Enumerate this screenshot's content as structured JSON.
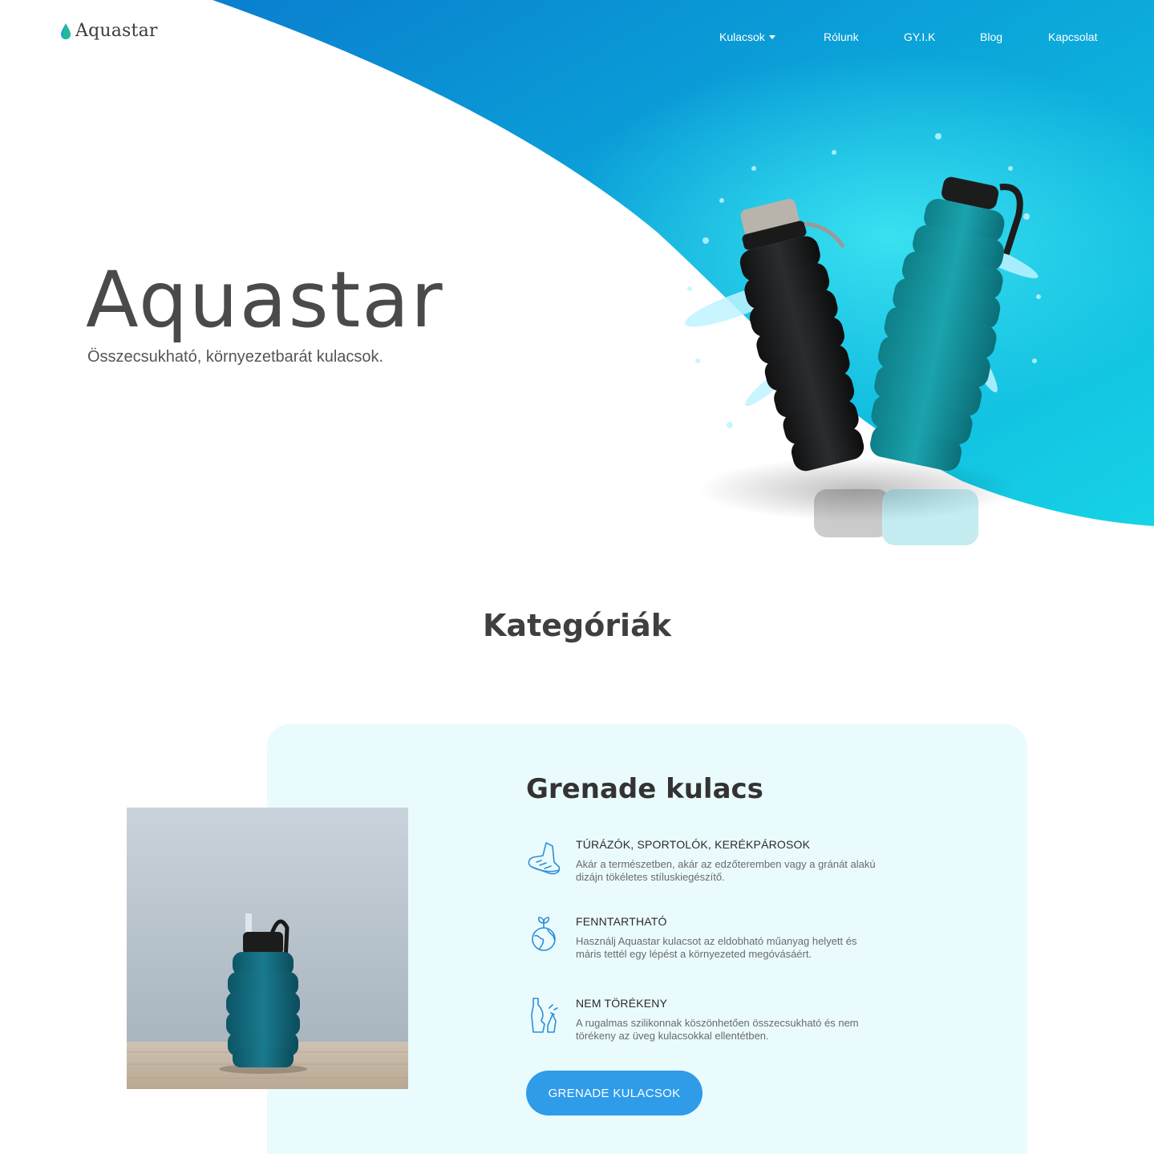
{
  "brand": {
    "logo_text": "Aquastar",
    "logo_icon": "water-drop-icon"
  },
  "nav": {
    "items": [
      {
        "label": "Kulacsok",
        "has_dropdown": true
      },
      {
        "label": "Rólunk"
      },
      {
        "label": "GY.I.K"
      },
      {
        "label": "Blog"
      },
      {
        "label": "Kapcsolat"
      }
    ]
  },
  "hero": {
    "title": "Aquastar",
    "subtitle": "Összecsukható, környezetbarát kulacsok."
  },
  "categories": {
    "heading": "Kategóriák",
    "card": {
      "title": "Grenade kulacs",
      "features": [
        {
          "icon": "running-shoe-icon",
          "title": "TÚRÁZÓK, SPORTOLÓK, KERÉKPÁROSOK",
          "text": "Akár a természetben, akár az edzőteremben vagy a gránát alakú dizájn tökéletes stíluskiegészítő."
        },
        {
          "icon": "earth-plant-icon",
          "title": "FENNTARTHATÓ",
          "text": "Használj Aquastar kulacsot az eldobható műanyag helyett és máris tettél egy lépést a környezeted megóvásáért."
        },
        {
          "icon": "broken-bottle-icon",
          "title": "NEM TÖRÉKENY",
          "text": "A rugalmas szilikonnak köszönhetően összecsukható és nem törékeny az üveg kulacsokkal ellentétben."
        }
      ],
      "button_label": "GRENADE KULACSOK"
    }
  },
  "colors": {
    "accent_blue": "#2f9cea",
    "wave_dark": "#0a8fd6",
    "wave_light": "#11c7e0",
    "card_bg": "#eafbfe"
  }
}
